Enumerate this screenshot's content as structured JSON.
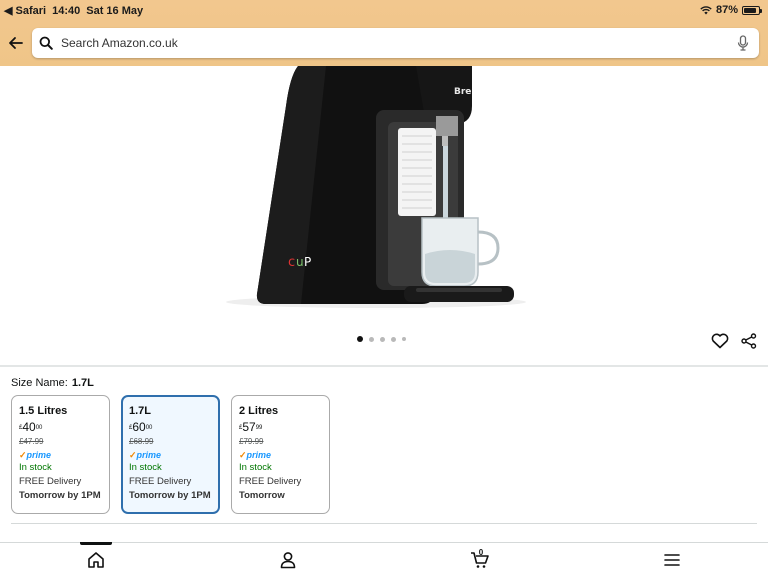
{
  "status_bar": {
    "back_app": "Safari",
    "time": "14:40",
    "date": "Sat 16 May",
    "battery": "87%"
  },
  "search": {
    "placeholder": "Search Amazon.co.uk"
  },
  "gallery": {
    "image_count": 5,
    "active_index": 0
  },
  "size": {
    "label": "Size Name:",
    "selected": "1.7L",
    "options": [
      {
        "title": "1.5 Litres",
        "currency": "£",
        "price_whole": "40",
        "price_fraction": "00",
        "old_price": "£47.99",
        "prime": "prime",
        "stock": "In stock",
        "delivery": "FREE Delivery",
        "when": "Tomorrow by 1PM"
      },
      {
        "title": "1.7L",
        "currency": "£",
        "price_whole": "60",
        "price_fraction": "00",
        "old_price": "£68.99",
        "prime": "prime",
        "stock": "In stock",
        "delivery": "FREE Delivery",
        "when": "Tomorrow by 1PM"
      },
      {
        "title": "2 Litres",
        "currency": "£",
        "price_whole": "57",
        "price_fraction": "99",
        "old_price": "£79.99",
        "prime": "prime",
        "stock": "In stock",
        "delivery": "FREE Delivery",
        "when": "Tomorrow"
      }
    ]
  },
  "bottom_nav": {
    "cart_count": "0",
    "items": [
      "home-icon",
      "account-icon",
      "cart-icon",
      "menu-icon"
    ]
  },
  "colors": {
    "header_bg": "#f2c78e",
    "selected_border": "#2f6fad",
    "in_stock": "#007600",
    "prime_blue": "#1a98ff"
  }
}
